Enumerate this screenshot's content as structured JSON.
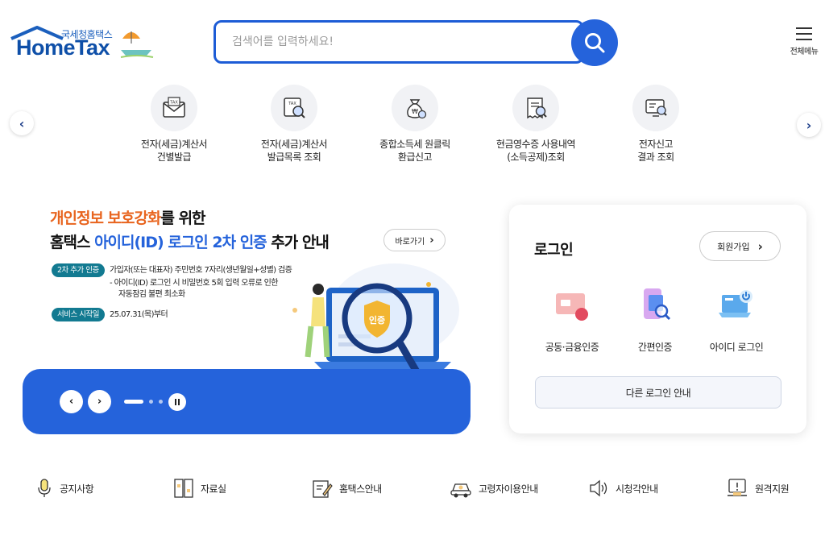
{
  "header": {
    "logo_sub": "국세청홈택스",
    "logo_main": "HomeTax",
    "search_placeholder": "검색어를 입력하세요!",
    "menu_label": "전체메뉴"
  },
  "quick_menu": [
    {
      "line1": "전자(세금)계산서",
      "line2": "건별발급",
      "icon": "tax-invoice-envelope-icon"
    },
    {
      "line1": "전자(세금)계산서",
      "line2": "발급목록 조회",
      "icon": "tax-invoice-search-icon"
    },
    {
      "line1": "종합소득세 원클릭",
      "line2": "환급신고",
      "icon": "money-bag-icon"
    },
    {
      "line1": "현금영수증 사용내역",
      "line2": "(소득공제)조회",
      "icon": "receipt-search-icon"
    },
    {
      "line1": "전자신고",
      "line2": "결과 조회",
      "icon": "report-result-icon"
    }
  ],
  "banner": {
    "title1_highlight": "개인정보 보호강화",
    "title1_rest": "를 위한",
    "title2_prefix": "홈택스 ",
    "title2_highlight": "아이디(ID) 로그인 2차 인증",
    "title2_rest": " 추가 안내",
    "goto_label": "바로가기",
    "tag1": "2차 추가 인증",
    "tag1_text": "가입자(또는 대표자) 주민번호 7자리(생년월일+성별) 검증",
    "bullet_line1": "- 아이디(ID) 로그인 시 비밀번호 5회 입력 오류로 인한",
    "bullet_line2": "자동잠김 불편 최소화",
    "tag2": "서비스 시작일",
    "tag2_text": "25.07.31(목)부터",
    "shield_label": "인증"
  },
  "login": {
    "title": "로그인",
    "join_label": "회원가입",
    "options": [
      {
        "label": "공동·금융인증",
        "icon": "certificate-card-icon"
      },
      {
        "label": "간편인증",
        "icon": "mobile-auth-icon"
      },
      {
        "label": "아이디 로그인",
        "icon": "id-login-laptop-icon"
      }
    ],
    "other_label": "다른 로그인 안내"
  },
  "bottom_links": [
    {
      "label": "공지사항",
      "icon": "microphone-icon"
    },
    {
      "label": "자료실",
      "icon": "archive-cabinet-icon"
    },
    {
      "label": "홈택스안내",
      "icon": "guide-pencil-icon"
    },
    {
      "label": "고령자이용안내",
      "icon": "senior-car-icon"
    },
    {
      "label": "시청각안내",
      "icon": "speaker-icon"
    },
    {
      "label": "원격지원",
      "icon": "remote-support-icon"
    }
  ],
  "colors": {
    "primary": "#2563db",
    "logo_blue": "#0e4fa8",
    "highlight_orange": "#e8641e",
    "tag_teal": "#127a91"
  }
}
